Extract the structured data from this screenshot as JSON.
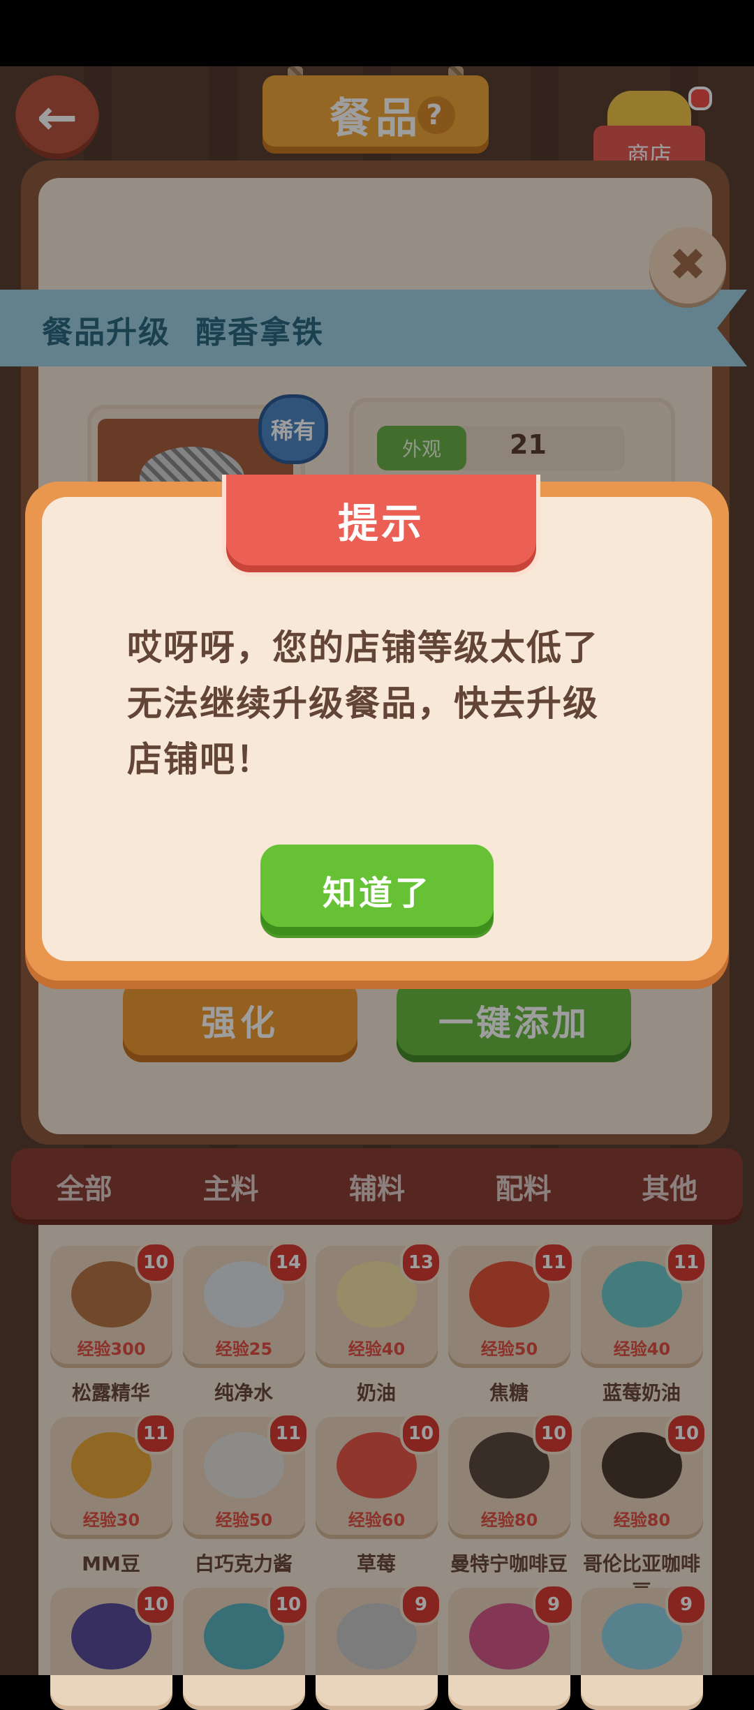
{
  "header": {
    "title": "餐品",
    "help_icon_text": "?",
    "shop_label": "商店"
  },
  "upgrade_panel": {
    "title": "餐品升级",
    "item_name": "醇香拿铁",
    "rarity_badge": "稀有",
    "stat_label": "外观",
    "stat_value": "21",
    "strengthen_button": "强化",
    "add_all_button": "一键添加"
  },
  "tabs": [
    "全部",
    "主料",
    "辅料",
    "配料",
    "其他"
  ],
  "ingredients": [
    {
      "name": "松露精华",
      "exp": "经验300",
      "count": "10",
      "color": "#b9744a"
    },
    {
      "name": "纯净水",
      "exp": "经验25",
      "count": "14",
      "color": "#dfe6ea"
    },
    {
      "name": "奶油",
      "exp": "经验40",
      "count": "13",
      "color": "#f4e2a8"
    },
    {
      "name": "焦糖",
      "exp": "经验50",
      "count": "11",
      "color": "#e2543a"
    },
    {
      "name": "蓝莓奶油",
      "exp": "经验40",
      "count": "11",
      "color": "#6fc7c9"
    },
    {
      "name": "MM豆",
      "exp": "经验30",
      "count": "11",
      "color": "#e8a93a"
    },
    {
      "name": "白巧克力酱",
      "exp": "经验50",
      "count": "11",
      "color": "#e4e1dc"
    },
    {
      "name": "草莓",
      "exp": "经验60",
      "count": "10",
      "color": "#e8574a"
    },
    {
      "name": "曼特宁咖啡豆",
      "exp": "经验80",
      "count": "10",
      "color": "#5b4a3f"
    },
    {
      "name": "哥伦比亚咖啡豆",
      "exp": "经验80",
      "count": "10",
      "color": "#4e3b31"
    },
    {
      "name": "",
      "exp": "",
      "count": "10",
      "color": "#5a4d9b"
    },
    {
      "name": "",
      "exp": "",
      "count": "10",
      "color": "#5bb3c0"
    },
    {
      "name": "",
      "exp": "",
      "count": "9",
      "color": "#c8c8c8"
    },
    {
      "name": "",
      "exp": "",
      "count": "9",
      "color": "#d65a8a"
    },
    {
      "name": "",
      "exp": "",
      "count": "9",
      "color": "#8fd0e6"
    }
  ],
  "dialog": {
    "title": "提示",
    "line1": "哎呀呀，您的店铺等级太低了",
    "line2": "无法继续升级餐品，快去升级",
    "line3": "店铺吧！",
    "ok_button": "知道了"
  },
  "icons": {
    "back": "arrow-left-icon",
    "close": "close-icon",
    "help": "question-icon",
    "shop": "shop-basket-icon"
  }
}
